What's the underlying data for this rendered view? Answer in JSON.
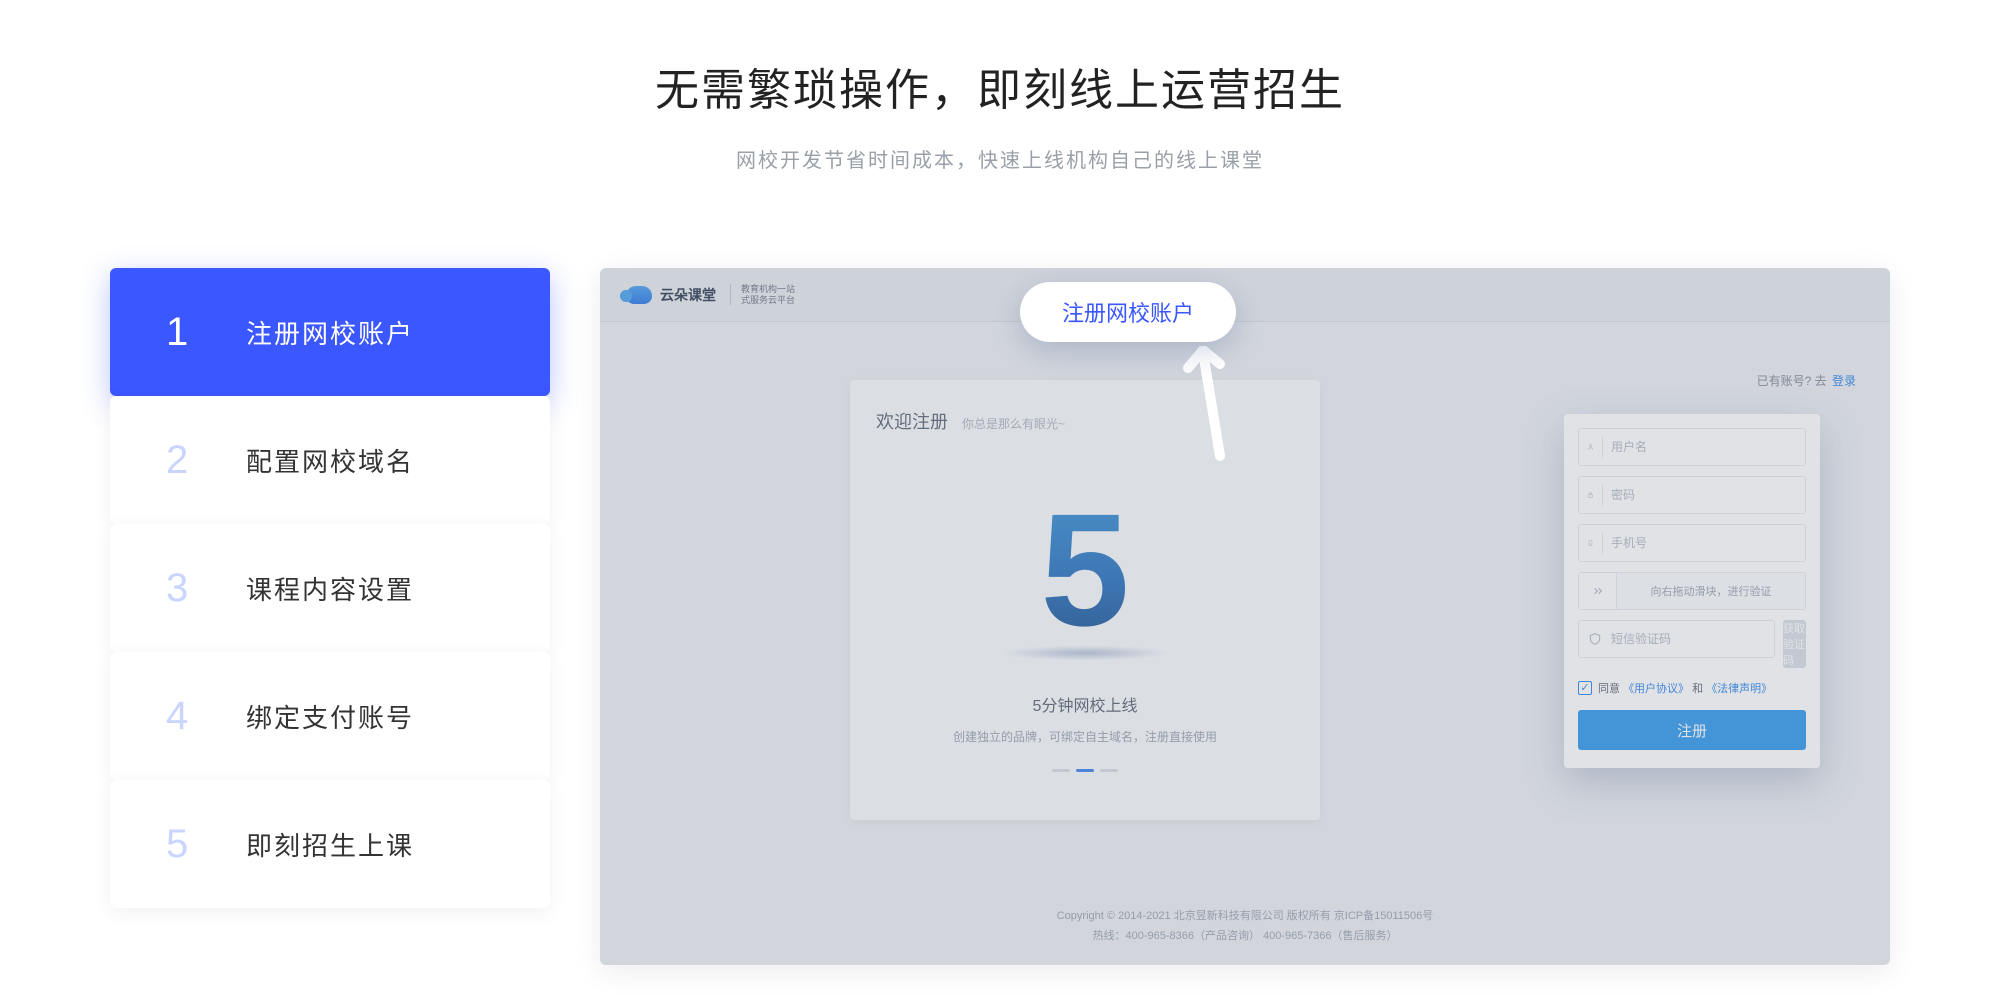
{
  "headline": {
    "title": "无需繁琐操作，即刻线上运营招生",
    "subtitle": "网校开发节省时间成本，快速上线机构自己的线上课堂"
  },
  "steps": [
    {
      "num": "1",
      "label": "注册网校账户",
      "active": true
    },
    {
      "num": "2",
      "label": "配置网校域名",
      "active": false
    },
    {
      "num": "3",
      "label": "课程内容设置",
      "active": false
    },
    {
      "num": "4",
      "label": "绑定支付账号",
      "active": false
    },
    {
      "num": "5",
      "label": "即刻招生上课",
      "active": false
    }
  ],
  "tooltip": {
    "text": "注册网校账户"
  },
  "preview": {
    "logo_text": "云朵课堂",
    "logo_sub_line1": "教育机构一站",
    "logo_sub_line2": "式服务云平台",
    "welcome_title": "欢迎注册",
    "welcome_hint": "你总是那么有眼光~",
    "big5_caption": "5分钟网校上线",
    "big5_sub": "创建独立的品牌，可绑定自主域名，注册直接使用",
    "login_hint_prefix": "已有账号? 去",
    "login_hint_link": "登录",
    "form": {
      "username_placeholder": "用户名",
      "password_placeholder": "密码",
      "phone_placeholder": "手机号",
      "slider_text": "向右拖动滑块，进行验证",
      "sms_placeholder": "短信验证码",
      "sms_button": "获取验证码",
      "agree_prefix": "同意",
      "agree_link1": "《用户协议》",
      "agree_and": "和",
      "agree_link2": "《法律声明》",
      "submit": "注册"
    },
    "footer_line1": "Copyright © 2014-2021 北京昱新科技有限公司 版权所有   京ICP备15011506号",
    "footer_line2": "热线：400-965-8366（产品咨询）  400-965-7366（售后服务）"
  }
}
